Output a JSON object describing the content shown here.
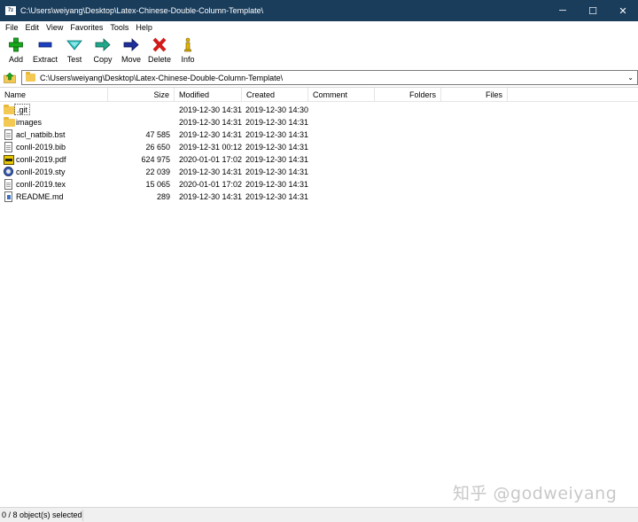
{
  "window": {
    "app_icon_text": "7z",
    "title": "C:\\Users\\weiyang\\Desktop\\Latex-Chinese-Double-Column-Template\\",
    "minimize_glyph": "─",
    "maximize_glyph": "☐",
    "close_glyph": "✕"
  },
  "menu": [
    "File",
    "Edit",
    "View",
    "Favorites",
    "Tools",
    "Help"
  ],
  "toolbar": {
    "add": "Add",
    "extract": "Extract",
    "test": "Test",
    "copy": "Copy",
    "move": "Move",
    "delete": "Delete",
    "info": "Info"
  },
  "address": {
    "path": "C:\\Users\\weiyang\\Desktop\\Latex-Chinese-Double-Column-Template\\",
    "dropdown_glyph": "⌄"
  },
  "columns": {
    "name": "Name",
    "size": "Size",
    "modified": "Modified",
    "created": "Created",
    "comment": "Comment",
    "folders": "Folders",
    "files": "Files"
  },
  "files": [
    {
      "name": ".git",
      "size": "",
      "modified": "2019-12-30 14:31",
      "created": "2019-12-30 14:30",
      "icon": "folder-icon"
    },
    {
      "name": "images",
      "size": "",
      "modified": "2019-12-30 14:31",
      "created": "2019-12-30 14:31",
      "icon": "folder-icon"
    },
    {
      "name": "acl_natbib.bst",
      "size": "47 585",
      "modified": "2019-12-30 14:31",
      "created": "2019-12-30 14:31",
      "icon": "file-icon"
    },
    {
      "name": "conll-2019.bib",
      "size": "26 650",
      "modified": "2019-12-31 00:12",
      "created": "2019-12-30 14:31",
      "icon": "file-icon"
    },
    {
      "name": "conll-2019.pdf",
      "size": "624 975",
      "modified": "2020-01-01 17:02",
      "created": "2019-12-30 14:31",
      "icon": "pdf-icon"
    },
    {
      "name": "conll-2019.sty",
      "size": "22 039",
      "modified": "2019-12-30 14:31",
      "created": "2019-12-30 14:31",
      "icon": "tex-style-icon"
    },
    {
      "name": "conll-2019.tex",
      "size": "15 065",
      "modified": "2020-01-01 17:02",
      "created": "2019-12-30 14:31",
      "icon": "file-icon"
    },
    {
      "name": "README.md",
      "size": "289",
      "modified": "2019-12-30 14:31",
      "created": "2019-12-30 14:31",
      "icon": "markdown-file-icon"
    }
  ],
  "watermark": "知乎 @godweiyang",
  "status": {
    "selection": "0 / 8 object(s) selected"
  }
}
